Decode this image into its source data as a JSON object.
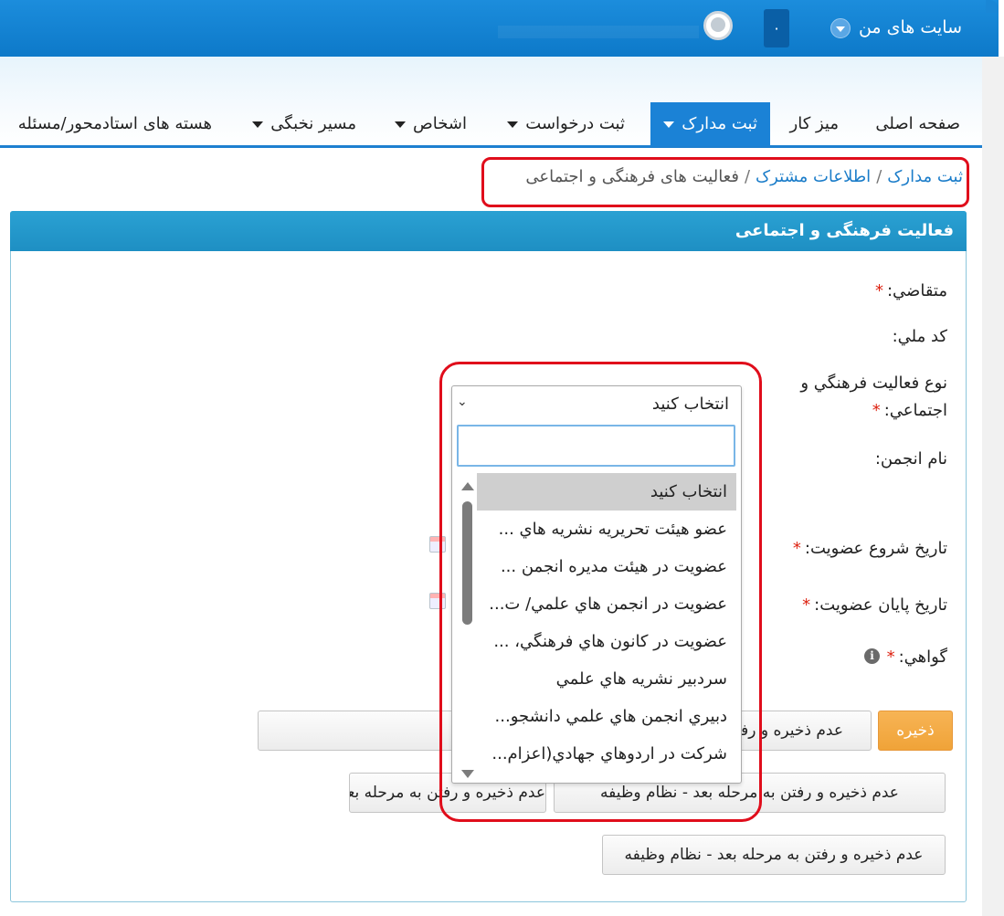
{
  "header": {
    "my_sites": "سایت های من",
    "notifications_count": "۰"
  },
  "nav": {
    "tabs": [
      {
        "label": "صفحه اصلی",
        "has_menu": false
      },
      {
        "label": "میز کار",
        "has_menu": false
      },
      {
        "label": "ثبت مدارک",
        "has_menu": true,
        "active": true
      },
      {
        "label": "ثبت درخواست",
        "has_menu": true
      },
      {
        "label": "اشخاص",
        "has_menu": true
      },
      {
        "label": "مسیر نخبگی",
        "has_menu": true
      },
      {
        "label": "هسته های استادمحور/مسئله",
        "has_menu": false
      }
    ]
  },
  "breadcrumb": {
    "item1": "ثبت مدارک",
    "item2": "اطلاعات مشترک",
    "current": "فعالیت های فرهنگی و اجتماعی",
    "separator": "/"
  },
  "panel": {
    "title": "فعالیت فرهنگی و اجتماعی"
  },
  "form": {
    "applicant_label": "متقاضي:",
    "national_code_label": "کد ملي:",
    "activity_type_label_line1": "نوع فعاليت فرهنگي و",
    "activity_type_label_line2": "اجتماعي:",
    "association_name_label": "نام انجمن:",
    "start_date_label": "تاريخ شروع عضويت:",
    "end_date_label": "تاريخ پايان عضويت:",
    "certificate_label": "گواهي:",
    "required_mark": "*"
  },
  "dropdown": {
    "selected": "انتخاب کنید",
    "search_placeholder": "",
    "options": [
      "انتخاب کنید",
      "عضو هيئت تحريريه نشريه هاي ...",
      "عضويت در هيئت مديره انجمن ...",
      "عضويت در انجمن هاي علمي/ ت...",
      "عضويت در کانون هاي فرهنگي، ...",
      "سردبير نشريه هاي علمي",
      "دبيري انجمن هاي علمي دانشجو...",
      "شرکت در اردوهاي جهادي(اعزام..."
    ]
  },
  "buttons": {
    "save": "ذخيره",
    "prev_step": "عدم ذخيره و رفتن به مرحله قبل - دانش آموخته برتر",
    "next_step_service": "عدم ذخيره و رفتن به مرحله بعد - نظام وظيفه",
    "partial_left_fragment": "عدم ذخيره و رفتن به مرحله بعد - نظام وظيفه"
  },
  "colors": {
    "topbar": "#1689d9",
    "active_tab": "#1b82d6",
    "panel_header": "#2298cc",
    "save_button": "#f2a640",
    "highlight_box": "#e00d1b"
  }
}
